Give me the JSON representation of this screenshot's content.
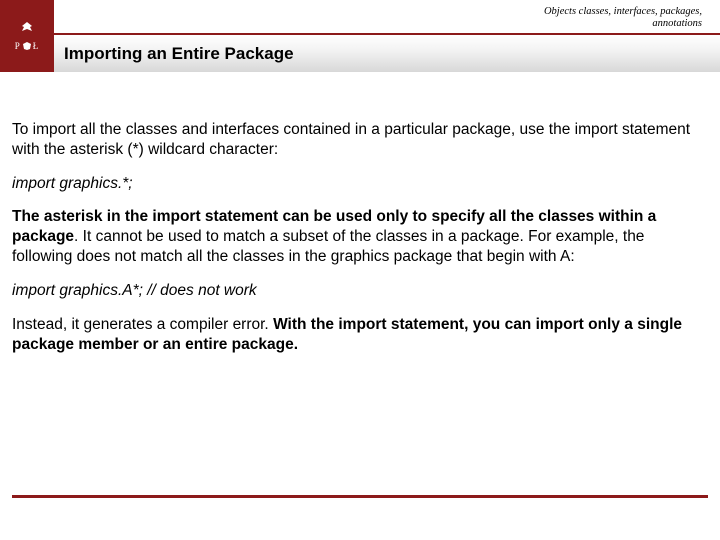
{
  "header": {
    "breadcrumb_line1": "Objects classes, interfaces, packages,",
    "breadcrumb_line2": "annotations",
    "logo_left": "P",
    "logo_right": "Ł",
    "title": "Importing an Entire Package"
  },
  "body": {
    "p1": "To import all the classes and interfaces contained in a particular package, use the import statement with the asterisk (*) wildcard character:",
    "code1": "import graphics.*;",
    "p2_bold": "The asterisk in the import statement can be used only to specify all the classes within a package",
    "p2_rest": ". It cannot be used to match a subset of the classes in a package. For example, the following does not match all the classes in the graphics package that begin with A:",
    "code2": "import graphics.A*; // does not work",
    "p3_lead": "Instead, it generates a compiler error. ",
    "p3_bold": "With the import statement, you can import only a single package member or an entire package."
  }
}
